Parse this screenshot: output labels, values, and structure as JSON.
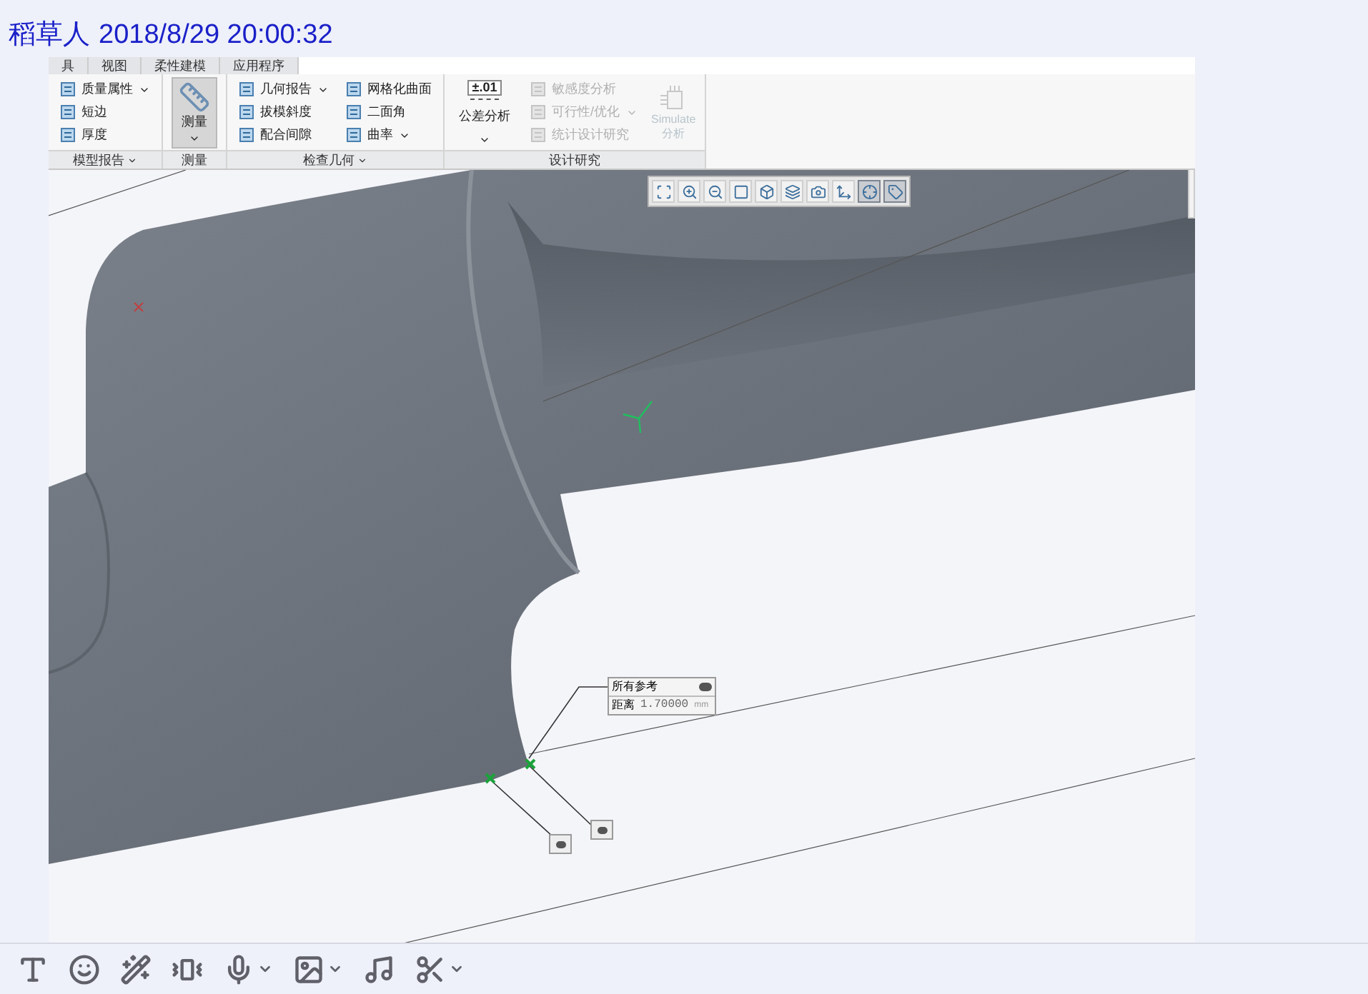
{
  "message": {
    "sender": "稻草人",
    "time": "2018/8/29 20:00:32"
  },
  "app": {
    "tabs": [
      {
        "label": "具"
      },
      {
        "label": "视图"
      },
      {
        "label": "柔性建模"
      },
      {
        "label": "应用程序"
      }
    ],
    "groups": [
      {
        "label": "模型报告",
        "dropdown": true,
        "items": [
          {
            "label": "质量属性",
            "dropdown": true,
            "disabled": false
          },
          {
            "label": "短边",
            "dropdown": false,
            "disabled": false
          },
          {
            "label": "厚度",
            "dropdown": false,
            "disabled": false
          }
        ]
      },
      {
        "label": "测量",
        "dropdown": false,
        "big_button": {
          "label": "测量",
          "kind": "ruler",
          "disabled": false,
          "selected": true
        }
      },
      {
        "label": "检查几何",
        "dropdown": true,
        "items": [
          {
            "label": "几何报告",
            "dropdown": true,
            "disabled": false
          },
          {
            "label": "拔模斜度",
            "dropdown": false,
            "disabled": false
          },
          {
            "label": "配合间隙",
            "dropdown": false,
            "disabled": false
          },
          {
            "label": "网格化曲面",
            "dropdown": false,
            "disabled": false
          },
          {
            "label": "二面角",
            "dropdown": false,
            "disabled": false
          },
          {
            "label": "曲率",
            "dropdown": true,
            "disabled": false
          }
        ]
      },
      {
        "label": "设计研究",
        "dropdown": false,
        "big_button": {
          "label": "公差分析",
          "kind": "tolerance",
          "badge": "±.01",
          "disabled": false,
          "selected": false
        },
        "items": [
          {
            "label": "敏感度分析",
            "dropdown": false,
            "disabled": true
          },
          {
            "label": "可行性/优化",
            "dropdown": true,
            "disabled": true
          },
          {
            "label": "统计设计研究",
            "dropdown": false,
            "disabled": true
          }
        ],
        "extra_button": {
          "label": "Simulate",
          "sublabel": "分析",
          "disabled": true
        }
      }
    ],
    "view_toolbar": [
      {
        "kind": "refit",
        "selected": false
      },
      {
        "kind": "zoom-in",
        "selected": false
      },
      {
        "kind": "zoom-out",
        "selected": false
      },
      {
        "kind": "repaint",
        "selected": false
      },
      {
        "kind": "display-style",
        "selected": false
      },
      {
        "kind": "saved-views",
        "selected": false
      },
      {
        "kind": "view-manager",
        "selected": false
      },
      {
        "kind": "datum",
        "selected": false
      },
      {
        "kind": "spin-center",
        "selected": true
      },
      {
        "kind": "annotations",
        "selected": true
      }
    ],
    "callout": {
      "title": "所有参考",
      "label": "距离",
      "value": "1.70000",
      "unit": "mm"
    }
  },
  "chat_toolbar": [
    {
      "kind": "font",
      "dropdown": false
    },
    {
      "kind": "emoji",
      "dropdown": false
    },
    {
      "kind": "magic",
      "dropdown": false
    },
    {
      "kind": "shake",
      "dropdown": false
    },
    {
      "kind": "voice",
      "dropdown": true
    },
    {
      "kind": "image",
      "dropdown": true
    },
    {
      "kind": "music",
      "dropdown": false
    },
    {
      "kind": "scissors",
      "dropdown": true
    }
  ]
}
